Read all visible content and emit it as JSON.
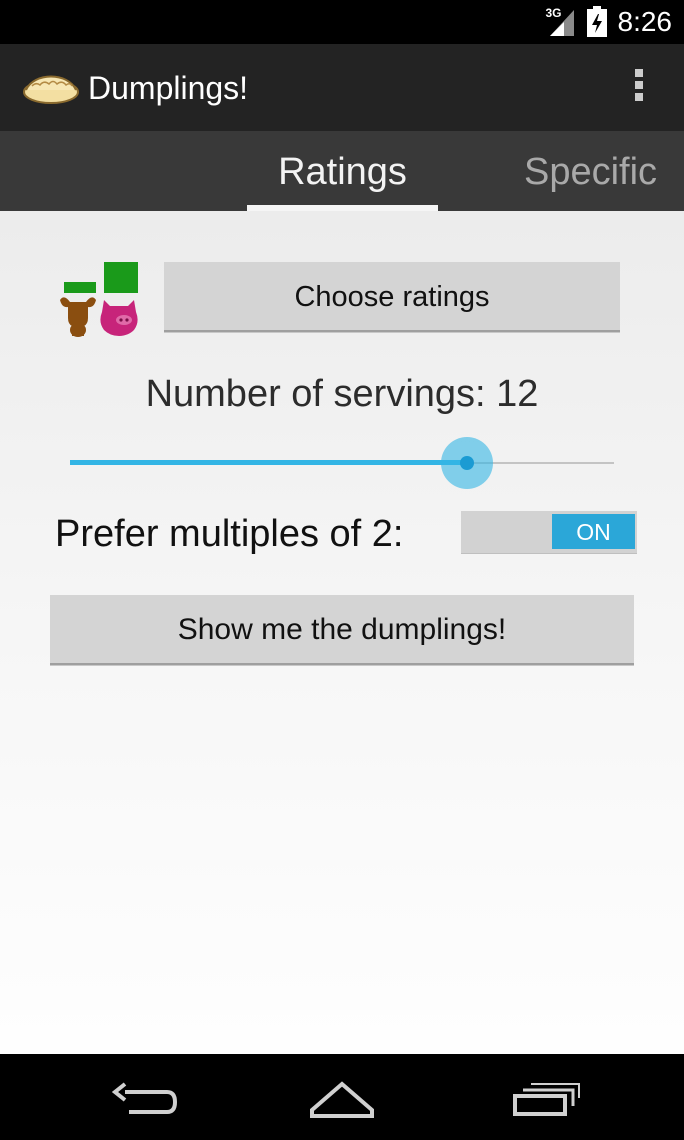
{
  "status_bar": {
    "network_label": "3G",
    "time": "8:26"
  },
  "action_bar": {
    "title": "Dumplings!",
    "logo_icon": "dumpling-icon",
    "overflow_icon": "overflow-menu-icon"
  },
  "tabs": {
    "items": [
      {
        "label": "Ratings",
        "selected": true
      },
      {
        "label": "Specific",
        "selected": false
      }
    ]
  },
  "ratings_section": {
    "icon": "ratings-icon",
    "choose_label": "Choose ratings"
  },
  "servings": {
    "label": "Number of servings: 12",
    "slider_fraction": 0.73
  },
  "prefer": {
    "label": "Prefer multiples of 2:",
    "toggle_text": "ON",
    "toggle_on": true
  },
  "show_button": {
    "label": "Show me the dumplings!"
  },
  "nav_bar": {
    "buttons": [
      "back-icon",
      "home-icon",
      "recents-icon"
    ]
  },
  "colors": {
    "accent": "#33b5e5",
    "toggle_on": "#2ba7d8",
    "action_bar": "#232323",
    "tab_strip": "#393939"
  }
}
